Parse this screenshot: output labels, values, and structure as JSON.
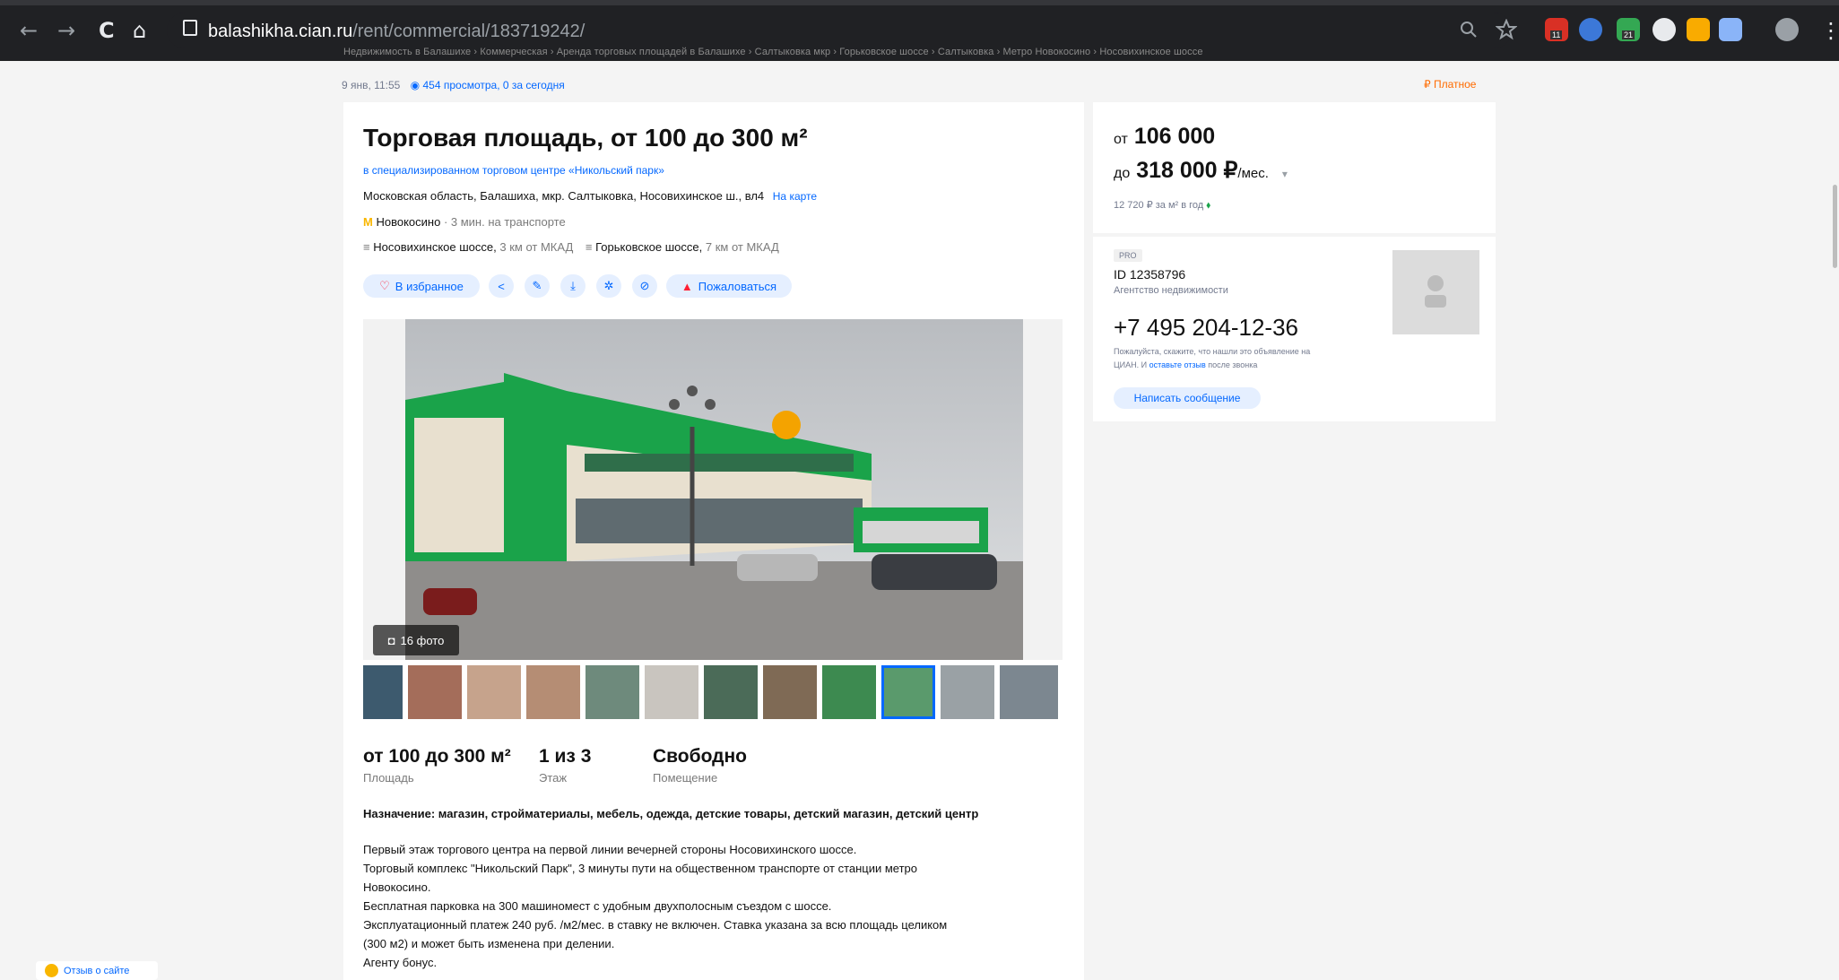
{
  "browser": {
    "url_host": "balashikha.cian.ru",
    "url_path": "/rent/commercial/183719242/",
    "back_icon": "←",
    "forward_icon": "→",
    "reload_icon": "C",
    "home_icon": "⌂",
    "extension_badges": [
      "11",
      "21"
    ]
  },
  "breadcrumbs": "Недвижимость в Балашихе  ›  Коммерческая  ›  Аренда торговых площадей в Балашихе  ›  Салтыковка мкр  ›  Горьковское шоссе  ›  Салтыковка  ›  Метро Новокосино  ›  Носовихинское шоссе",
  "meta": {
    "date": "9 янв, 11:55",
    "views": "454 просмотра, 0 за сегодня",
    "paid": "Платное"
  },
  "listing": {
    "title": "Торговая площадь, от 100 до 300 м²",
    "mall": "в специализированном торговом центре «Никольский парк»",
    "address": "Московская область, Балашиха, мкр. Салтыковка, Носовихинское ш., вл4",
    "map_link": "На карте",
    "metro_name": "Новокосино",
    "metro_time": "· 3 мин. на транспорте",
    "highway1": "Носовихинское шоссе,",
    "highway1_dist": "3 км от МКАД",
    "highway2": "Горьковское шоссе,",
    "highway2_dist": "7 км от МКАД",
    "actions": {
      "favorite": "В избранное",
      "complain": "Пожаловаться"
    },
    "photo_count": "16 фото",
    "facts": [
      {
        "value": "от 100 до 300 м²",
        "label": "Площадь"
      },
      {
        "value": "1 из 3",
        "label": "Этаж"
      },
      {
        "value": "Свободно",
        "label": "Помещение"
      }
    ],
    "purpose": "Назначение: магазин, стройматериалы, мебель, одежда, детские товары, детский магазин, детский центр",
    "description": [
      "Первый этаж торгового центра на первой линии вечерней стороны Носовихинского шоссе.",
      "Торговый комплекс \"Никольский Парк\", 3 минуты пути на общественном транспорте от станции метро",
      "Новокосино.",
      "Бесплатная парковка на 300 машиномест с удобным двухполосным съездом с шоссе.",
      "Эксплуатационный платеж 240 руб. /м2/мес. в ставку не включен. Ставка указана за всю площадь целиком",
      "(300 м2) и может быть изменена при делении.",
      "Агенту бонус."
    ]
  },
  "price": {
    "from_prefix": "от",
    "from": "106 000",
    "to_prefix": "до",
    "to": "318 000 ₽",
    "unit": "/мес.",
    "per_m2": "12 720 ₽ за м² в год"
  },
  "agent": {
    "badge": "PRO",
    "id": "ID 12358796",
    "type": "Агентство недвижимости",
    "phone": "+7 495 204-12-36",
    "note_1": "Пожалуйста, скажите, что нашли это объявление на",
    "note_2_prefix": "ЦИАН. И",
    "note_2_link": "оставьте отзыв",
    "note_2_suffix": "после звонка",
    "message_button": "Написать сообщение"
  },
  "feedback": "Отзыв о сайте",
  "colors": {
    "accent": "#0468ff",
    "paid": "#ff6b00",
    "complain": "#ff1f34",
    "mall_green": "#1aa34a"
  }
}
